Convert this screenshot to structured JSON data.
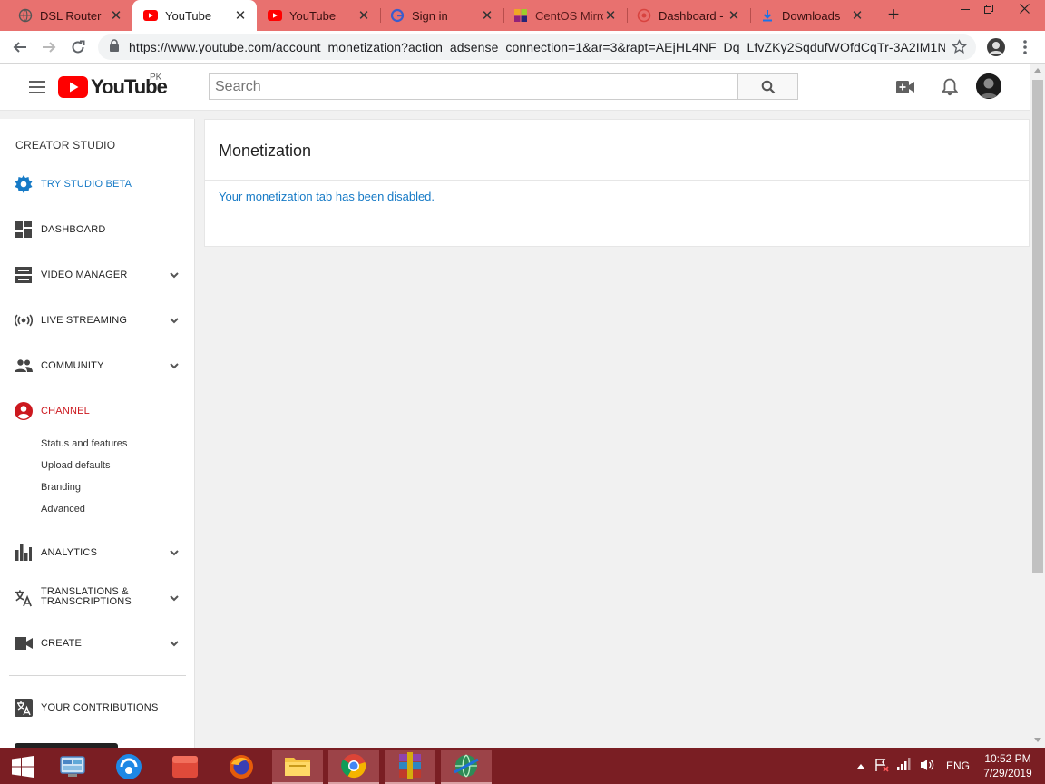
{
  "browser": {
    "tabs": [
      {
        "label": "DSL Router",
        "icon": "globe-icon"
      },
      {
        "label": "YouTube",
        "icon": "youtube-icon",
        "active": true
      },
      {
        "label": "YouTube",
        "icon": "youtube-icon"
      },
      {
        "label": "Sign in",
        "icon": "google-icon"
      },
      {
        "label": "CentOS Mirro",
        "icon": "centos-icon"
      },
      {
        "label": "Dashboard -",
        "icon": "dashboard-icon"
      },
      {
        "label": "Downloads",
        "icon": "download-icon"
      }
    ],
    "close_glyph": "✕",
    "new_tab_glyph": "+",
    "url": "https://www.youtube.com/account_monetization?action_adsense_connection=1&ar=3&rapt=AEjHL4NF_Dq_LfvZKy2SqdufWOfdCqTr-3A2IM1N...",
    "tabstrip_color": "#e8716f"
  },
  "masthead": {
    "logo_text": "YouTube",
    "region": "PK",
    "search_placeholder": "Search"
  },
  "sidebar": {
    "title": "CREATOR STUDIO",
    "items": [
      {
        "label": "TRY STUDIO BETA",
        "icon": "gear-icon",
        "style": "blue",
        "expandable": false
      },
      {
        "label": "DASHBOARD",
        "icon": "dashboard-icon",
        "expandable": false
      },
      {
        "label": "VIDEO MANAGER",
        "icon": "video-manager-icon",
        "expandable": true
      },
      {
        "label": "LIVE STREAMING",
        "icon": "live-streaming-icon",
        "expandable": true
      },
      {
        "label": "COMMUNITY",
        "icon": "community-icon",
        "expandable": true
      },
      {
        "label": "CHANNEL",
        "icon": "channel-icon",
        "style": "red",
        "expandable": false
      },
      {
        "label": "ANALYTICS",
        "icon": "analytics-icon",
        "expandable": true
      },
      {
        "label": "TRANSLATIONS & TRANSCRIPTIONS",
        "label_line1": "TRANSLATIONS &",
        "label_line2": "TRANSCRIPTIONS",
        "icon": "translate-icon",
        "expandable": true
      },
      {
        "label": "CREATE",
        "icon": "create-icon",
        "expandable": true
      },
      {
        "label": "YOUR CONTRIBUTIONS",
        "icon": "contributions-icon",
        "expandable": false
      }
    ],
    "channel_subitems": [
      "Status and features",
      "Upload defaults",
      "Branding",
      "Advanced"
    ]
  },
  "main": {
    "title": "Monetization",
    "message": "Your monetization tab has been disabled."
  },
  "taskbar": {
    "apps": [
      "windows-start-icon",
      "file-explorer-network-icon",
      "app-blue-icon",
      "app-red-icon",
      "firefox-icon",
      "file-manager-icon",
      "chrome-icon",
      "winrar-icon",
      "network-globe-icon"
    ],
    "language": "ENG",
    "time": "10:52 PM",
    "date": "7/29/2019",
    "color": "#7a1e23"
  },
  "colors": {
    "link_blue": "#167ac6",
    "channel_red": "#cc181e",
    "youtube_red": "#ff0000"
  }
}
